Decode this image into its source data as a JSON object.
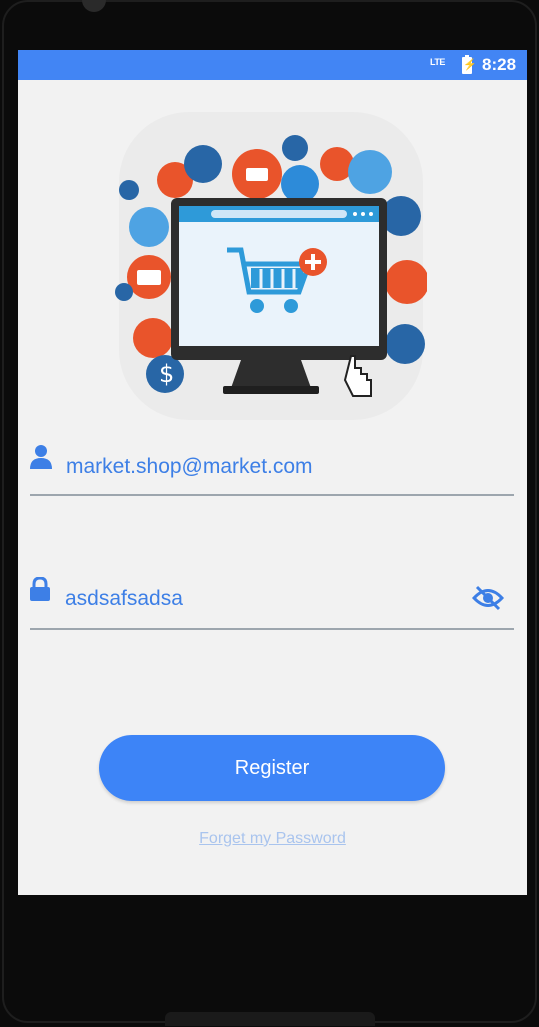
{
  "status_bar": {
    "network": "LTE",
    "time": "8:28"
  },
  "hero": {
    "icon": "computer-shopping-cart-illustration"
  },
  "form": {
    "email_value": "market.shop@market.com",
    "password_value": "asdsafsadsa"
  },
  "actions": {
    "register_label": "Register",
    "forgot_label": "Forget my Password"
  },
  "colors": {
    "accent": "#4285f4",
    "button": "#3d84f7",
    "text_blue": "#3d7fe6",
    "screen_bg": "#f2f2f2"
  }
}
